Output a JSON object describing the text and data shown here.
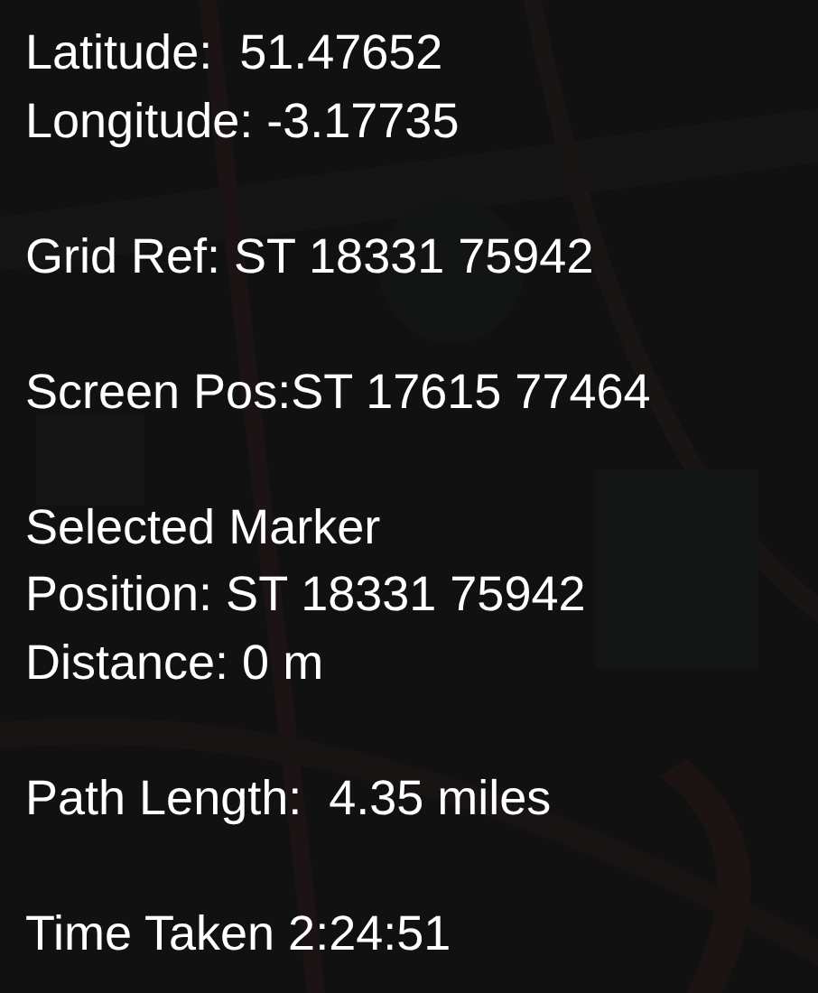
{
  "groups": [
    {
      "lines": [
        "Latitude:  51.47652",
        "Longitude: -3.17735"
      ]
    },
    {
      "lines": [
        "Grid Ref: ST 18331 75942"
      ]
    },
    {
      "lines": [
        "Screen Pos:ST 17615 77464"
      ]
    },
    {
      "lines": [
        "Selected Marker",
        "Position: ST 18331 75942",
        "Distance: 0 m"
      ]
    },
    {
      "lines": [
        "Path Length:  4.35 miles"
      ]
    },
    {
      "lines": [
        "Time Taken 2:24:51"
      ]
    }
  ]
}
